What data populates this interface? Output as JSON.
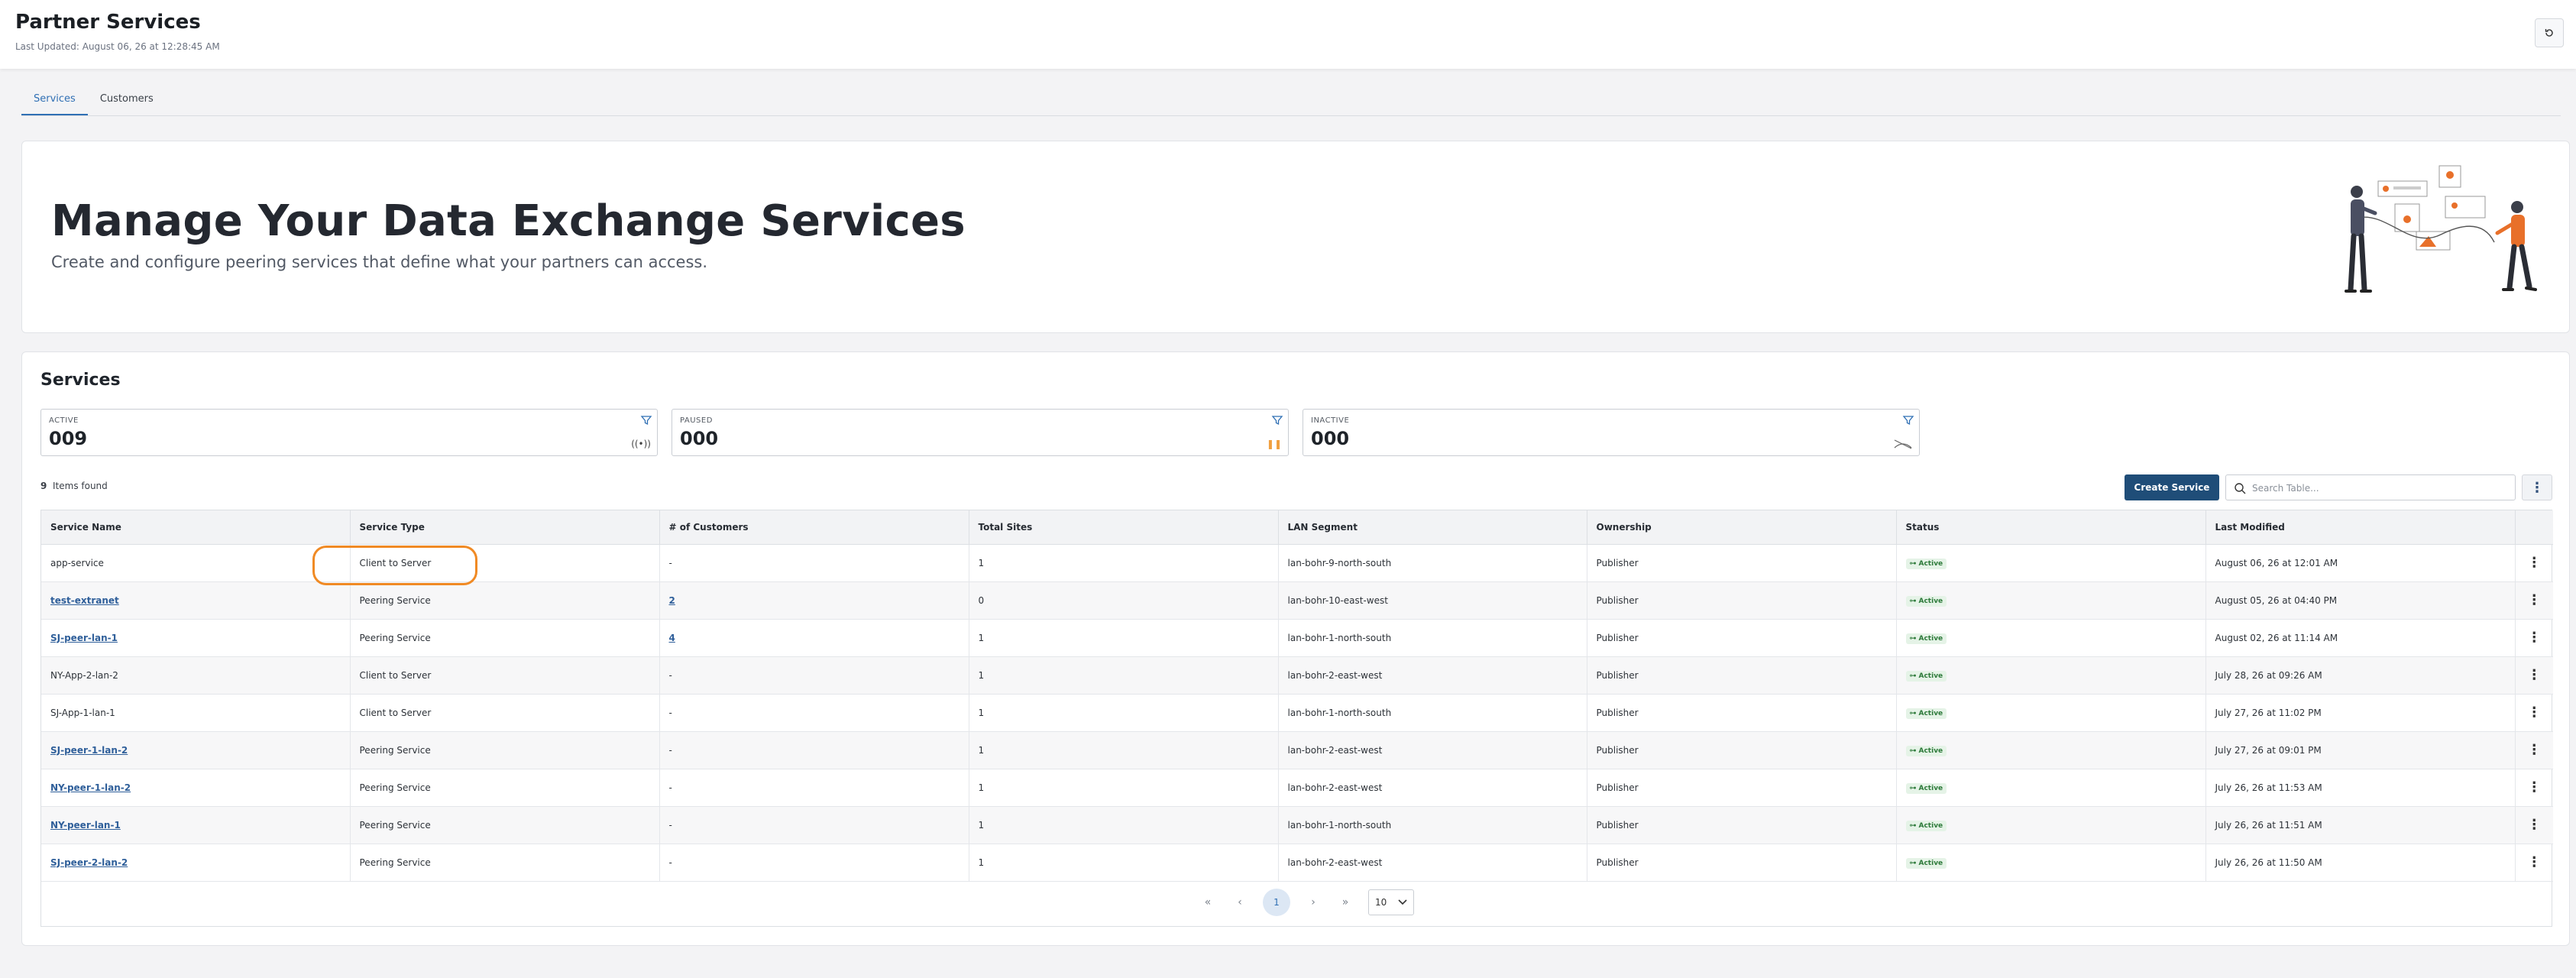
{
  "header": {
    "title": "Partner Services",
    "last_updated": "Last Updated: August 06, 26 at 12:28:45 AM"
  },
  "tabs": [
    {
      "label": "Services",
      "active": true
    },
    {
      "label": "Customers",
      "active": false
    }
  ],
  "hero": {
    "title": "Manage Your Data Exchange Services",
    "subtitle": "Create and configure peering services that define what your partners can access."
  },
  "services": {
    "title": "Services",
    "stats": [
      {
        "label": "ACTIVE",
        "value": "009",
        "icon": "broadcast-icon"
      },
      {
        "label": "PAUSED",
        "value": "000",
        "icon": "pause-icon"
      },
      {
        "label": "INACTIVE",
        "value": "000",
        "icon": "signal-off-icon"
      }
    ],
    "found_count": "9",
    "found_label": "Items found",
    "create_label": "Create Service",
    "search_placeholder": "Search Table..."
  },
  "table": {
    "columns": [
      "Service Name",
      "Service Type",
      "# of Customers",
      "Total Sites",
      "LAN Segment",
      "Ownership",
      "Status",
      "Last Modified"
    ],
    "rows": [
      {
        "name": "app-service",
        "link": false,
        "type": "Client to Server",
        "customers": "-",
        "sites": "1",
        "lan": "lan-bohr-9-north-south",
        "owner": "Publisher",
        "status": "Active",
        "modified": "August 06, 26 at 12:01 AM"
      },
      {
        "name": "test-extranet",
        "link": true,
        "type": "Peering Service",
        "customers": "2",
        "sites": "0",
        "lan": "lan-bohr-10-east-west",
        "owner": "Publisher",
        "status": "Active",
        "modified": "August 05, 26 at 04:40 PM"
      },
      {
        "name": "SJ-peer-lan-1",
        "link": true,
        "type": "Peering Service",
        "customers": "4",
        "sites": "1",
        "lan": "lan-bohr-1-north-south",
        "owner": "Publisher",
        "status": "Active",
        "modified": "August 02, 26 at 11:14 AM"
      },
      {
        "name": "NY-App-2-lan-2",
        "link": false,
        "type": "Client to Server",
        "customers": "-",
        "sites": "1",
        "lan": "lan-bohr-2-east-west",
        "owner": "Publisher",
        "status": "Active",
        "modified": "July 28, 26 at 09:26 AM"
      },
      {
        "name": "SJ-App-1-lan-1",
        "link": false,
        "type": "Client to Server",
        "customers": "-",
        "sites": "1",
        "lan": "lan-bohr-1-north-south",
        "owner": "Publisher",
        "status": "Active",
        "modified": "July 27, 26 at 11:02 PM"
      },
      {
        "name": "SJ-peer-1-lan-2",
        "link": true,
        "type": "Peering Service",
        "customers": "-",
        "sites": "1",
        "lan": "lan-bohr-2-east-west",
        "owner": "Publisher",
        "status": "Active",
        "modified": "July 27, 26 at 09:01 PM"
      },
      {
        "name": "NY-peer-1-lan-2",
        "link": true,
        "type": "Peering Service",
        "customers": "-",
        "sites": "1",
        "lan": "lan-bohr-2-east-west",
        "owner": "Publisher",
        "status": "Active",
        "modified": "July 26, 26 at 11:53 AM"
      },
      {
        "name": "NY-peer-lan-1",
        "link": true,
        "type": "Peering Service",
        "customers": "-",
        "sites": "1",
        "lan": "lan-bohr-1-north-south",
        "owner": "Publisher",
        "status": "Active",
        "modified": "July 26, 26 at 11:51 AM"
      },
      {
        "name": "SJ-peer-2-lan-2",
        "link": true,
        "type": "Peering Service",
        "customers": "-",
        "sites": "1",
        "lan": "lan-bohr-2-east-west",
        "owner": "Publisher",
        "status": "Active",
        "modified": "July 26, 26 at 11:50 AM"
      }
    ]
  },
  "pagination": {
    "current_page": "1",
    "page_size": "10",
    "first": "«",
    "prev": "‹",
    "next": "›",
    "last": "»"
  },
  "colors": {
    "primary": "#1f4d78",
    "accent": "#2f6fb4",
    "highlight": "#f08a24",
    "active_badge": "#2d7a3a"
  }
}
